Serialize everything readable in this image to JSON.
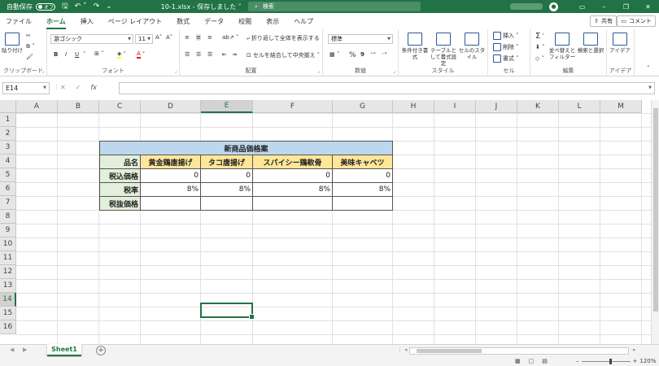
{
  "titlebar": {
    "autosave_label": "自動保存",
    "autosave_state": "オフ",
    "filename": "10-1.xlsx - 保存しました ˅",
    "search_placeholder": "検索"
  },
  "tabs": [
    "ファイル",
    "ホーム",
    "挿入",
    "ページ レイアウト",
    "数式",
    "データ",
    "校閲",
    "表示",
    "ヘルプ"
  ],
  "share_label": "共有",
  "comment_label": "コメント",
  "ribbon": {
    "clipboard": {
      "label": "クリップボード",
      "paste": "貼り付け"
    },
    "font": {
      "label": "フォント",
      "font_name": "游ゴシック",
      "font_size": "11",
      "grow": "A˄",
      "shrink": "A˅",
      "bold": "B",
      "italic": "I",
      "underline": "U"
    },
    "alignment": {
      "label": "配置",
      "wrap": "折り返して全体を表示する",
      "merge": "セルを結合して中央揃え"
    },
    "number": {
      "label": "数値",
      "format": "標準",
      "percent": "%",
      "comma": "9"
    },
    "styles": {
      "label": "スタイル",
      "conditional": "条件付き書式",
      "table": "テーブルとして書式設定",
      "cell": "セルのスタイル"
    },
    "cells": {
      "label": "セル",
      "insert": "挿入",
      "delete": "削除",
      "format": "書式"
    },
    "editing": {
      "label": "編集",
      "sum": "Σ",
      "sort": "並べ替えとフィルター",
      "find": "検索と選択"
    },
    "ideas": {
      "label": "アイデア",
      "ideas": "アイデア"
    }
  },
  "formula_bar": {
    "name_box": "E14",
    "cancel": "✕",
    "enter": "✓",
    "fx": "fx",
    "value": ""
  },
  "columns": [
    "A",
    "B",
    "C",
    "D",
    "E",
    "F",
    "G",
    "H",
    "I",
    "J",
    "K",
    "L",
    "M"
  ],
  "rows": [
    "1",
    "2",
    "3",
    "4",
    "5",
    "6",
    "7",
    "8",
    "9",
    "10",
    "11",
    "12",
    "13",
    "14",
    "15",
    "16"
  ],
  "active_cell": {
    "col": "E",
    "row": "14"
  },
  "table": {
    "title": "新商品価格案",
    "header_label": "品名",
    "products": [
      "黄金鶏唐揚げ",
      "タコ唐揚げ",
      "スパイシー鶏軟骨",
      "美味キャベツ"
    ],
    "row_labels": [
      "税込価格",
      "税率",
      "税抜価格"
    ],
    "tax_included": [
      "0",
      "0",
      "0",
      "0"
    ],
    "tax_rate": [
      "8%",
      "8%",
      "8%",
      "8%"
    ],
    "tax_excluded": [
      "",
      "",
      "",
      ""
    ]
  },
  "sheet_tab": "Sheet1",
  "zoom_level": "120%"
}
